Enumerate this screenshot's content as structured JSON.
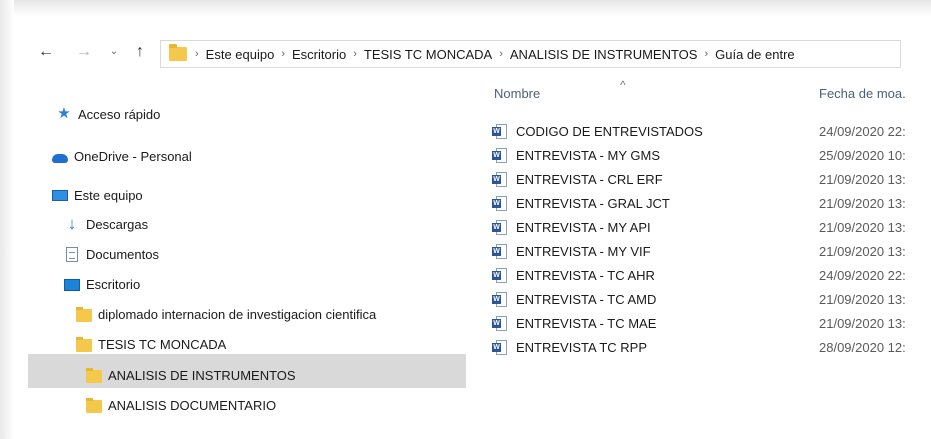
{
  "address_bar": {
    "breadcrumbs": [
      "Este equipo",
      "Escritorio",
      "TESIS TC MONCADA",
      "ANALISIS DE INSTRUMENTOS",
      "Guía de entre"
    ]
  },
  "sidebar": {
    "items": [
      {
        "label": "Acceso rápido",
        "icon": "star-icon"
      },
      {
        "label": "OneDrive - Personal",
        "icon": "cloud-icon"
      },
      {
        "label": "Este equipo",
        "icon": "computer-icon"
      },
      {
        "label": "Descargas",
        "icon": "download-arrow-icon"
      },
      {
        "label": "Documentos",
        "icon": "document-icon"
      },
      {
        "label": "Escritorio",
        "icon": "desktop-icon"
      },
      {
        "label": "diplomado internacion de investigacion cientifica",
        "icon": "folder-icon"
      },
      {
        "label": "TESIS TC MONCADA",
        "icon": "folder-icon"
      },
      {
        "label": "ANALISIS DE INSTRUMENTOS",
        "icon": "folder-icon",
        "selected": true
      },
      {
        "label": "ANALISIS DOCUMENTARIO",
        "icon": "folder-icon"
      }
    ]
  },
  "file_list": {
    "columns": {
      "name": "Nombre",
      "date": "Fecha de moa."
    },
    "files": [
      {
        "name": "CODIGO DE ENTREVISTADOS",
        "date": "24/09/2020 22:"
      },
      {
        "name": "ENTREVISTA  - MY GMS",
        "date": "25/09/2020 10:"
      },
      {
        "name": "ENTREVISTA - CRL ERF",
        "date": "21/09/2020 13:"
      },
      {
        "name": "ENTREVISTA - GRAL  JCT",
        "date": "21/09/2020 13:"
      },
      {
        "name": "ENTREVISTA - MY API",
        "date": "21/09/2020 13:"
      },
      {
        "name": "ENTREVISTA - MY VIF",
        "date": "21/09/2020 13:"
      },
      {
        "name": "ENTREVISTA - TC AHR",
        "date": "24/09/2020 22:"
      },
      {
        "name": "ENTREVISTA - TC AMD",
        "date": "21/09/2020 13:"
      },
      {
        "name": "ENTREVISTA - TC MAE",
        "date": "21/09/2020 13:"
      },
      {
        "name": "ENTREVISTA TC RPP",
        "date": "28/09/2020 12:"
      }
    ]
  }
}
